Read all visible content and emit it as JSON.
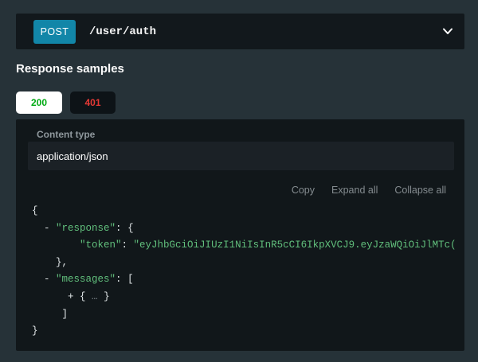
{
  "endpoint": {
    "method": "POST",
    "path": "/user/auth",
    "method_color": "#1286a8"
  },
  "section_title": "Response samples",
  "tabs": [
    {
      "code": "200",
      "type": "success",
      "text_color": "#00aa13",
      "bg_color": "#ffffff"
    },
    {
      "code": "401",
      "type": "error",
      "text_color": "#e53935",
      "bg_color": "#0d1317"
    }
  ],
  "content_type": {
    "label": "Content type",
    "value": "application/json"
  },
  "actions": {
    "copy": "Copy",
    "expand_all": "Expand all",
    "collapse_all": "Collapse all"
  },
  "icons": {
    "chevron_down": "expand/collapse endpoint"
  },
  "colors": {
    "page_bg": "#263238",
    "bar_bg": "#12181c",
    "panel_bg": "#11171a",
    "code_green": "#61bf7c",
    "code_punctuation": "#dfe4e6",
    "muted_gray": "#848b8f"
  },
  "code_lines": [
    [
      {
        "t": "{",
        "c": "pun"
      }
    ],
    [
      {
        "t": "  ",
        "c": "pun"
      },
      {
        "t": "- ",
        "c": "tog"
      },
      {
        "t": "\"response\"",
        "c": "key"
      },
      {
        "t": ": ",
        "c": "pun"
      },
      {
        "t": "{",
        "c": "pun"
      }
    ],
    [
      {
        "t": "        ",
        "c": "pun"
      },
      {
        "t": "\"token\"",
        "c": "key"
      },
      {
        "t": ": ",
        "c": "pun"
      },
      {
        "t": "\"eyJhbGciOiJIUzI1NiIsInR5cCI6IkpXVCJ9.eyJzaWQiOiJlMTc(",
        "c": "str"
      }
    ],
    [
      {
        "t": "    ",
        "c": "pun"
      },
      {
        "t": "},",
        "c": "pun"
      }
    ],
    [
      {
        "t": "  ",
        "c": "pun"
      },
      {
        "t": "- ",
        "c": "tog"
      },
      {
        "t": "\"messages\"",
        "c": "key"
      },
      {
        "t": ": ",
        "c": "pun"
      },
      {
        "t": "[",
        "c": "pun"
      }
    ],
    [
      {
        "t": "      ",
        "c": "pun"
      },
      {
        "t": "+ ",
        "c": "tog"
      },
      {
        "t": "{ ",
        "c": "pun"
      },
      {
        "t": "…",
        "c": "ell"
      },
      {
        "t": " }",
        "c": "pun"
      }
    ],
    [
      {
        "t": "     ",
        "c": "pun"
      },
      {
        "t": "]",
        "c": "pun"
      }
    ],
    [
      {
        "t": "}",
        "c": "pun"
      }
    ]
  ]
}
